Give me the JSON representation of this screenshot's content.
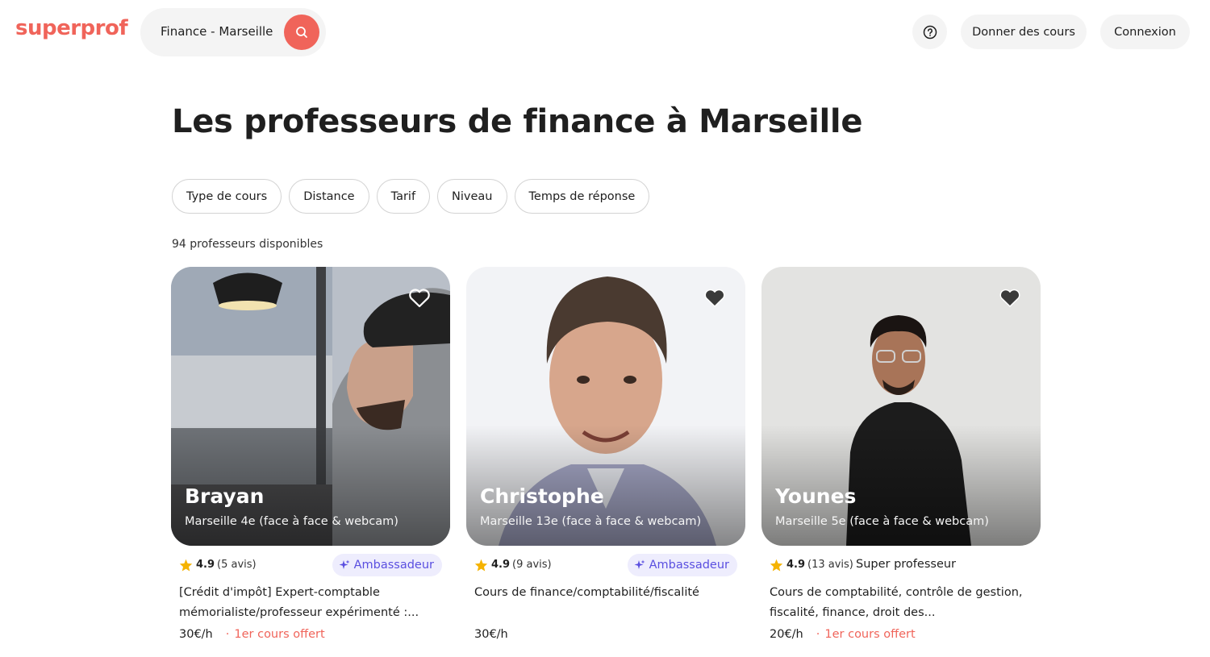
{
  "header": {
    "logo": "superprof",
    "search_query": "Finance - Marseille",
    "teach_label": "Donner des cours",
    "login_label": "Connexion"
  },
  "page": {
    "title": "Les professeurs de finance à Marseille",
    "count_text": "94 professeurs disponibles"
  },
  "filters": [
    "Type de cours",
    "Distance",
    "Tarif",
    "Niveau",
    "Temps de réponse"
  ],
  "teachers": [
    {
      "name": "Brayan",
      "location": "Marseille 4e (face à face & webcam)",
      "rating": "4.9",
      "reviews": "(5 avis)",
      "badge": "Ambassadeur",
      "description_line1": "[Crédit d'impôt] Expert-comptable",
      "description_line2": "mémorialiste/professeur expérimenté :...",
      "price": "30€/h",
      "offer": "1er cours offert"
    },
    {
      "name": "Christophe",
      "location": "Marseille 13e (face à face & webcam)",
      "rating": "4.9",
      "reviews": "(9 avis)",
      "badge": "Ambassadeur",
      "description_line1": "Cours de finance/comptabilité/fiscalité",
      "description_line2": "",
      "price": "30€/h",
      "offer": ""
    },
    {
      "name": "Younes",
      "location": "Marseille 5e (face à face & webcam)",
      "rating": "4.9",
      "reviews": "(13 avis)",
      "status": "Super professeur",
      "description_line1": "Cours de comptabilité, contrôle de gestion,",
      "description_line2": "fiscalité, finance, droit des...",
      "price": "20€/h",
      "offer": "1er cours offert"
    }
  ],
  "colors": {
    "brand": "#f0645a",
    "badge_text": "#5a4fe0",
    "badge_bg": "#eeedfd",
    "star": "#f5b301"
  },
  "icons": [
    "search-icon",
    "help-icon",
    "heart-icon",
    "star-icon",
    "sparkle-icon"
  ]
}
